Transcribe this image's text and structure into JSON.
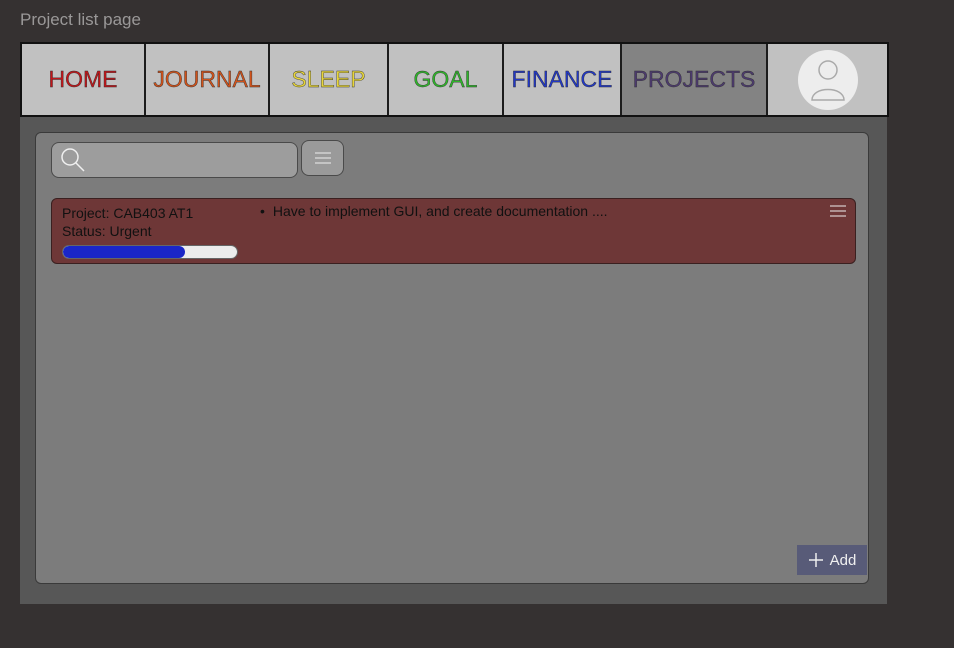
{
  "page": {
    "label": "Project list page"
  },
  "nav": {
    "tabs": [
      {
        "label": "HOME",
        "color": "#c0161a"
      },
      {
        "label": "JOURNAL",
        "color": "#d1521a"
      },
      {
        "label": "SLEEP",
        "color": "#e8d63a"
      },
      {
        "label": "GOAL",
        "color": "#2fb52a"
      },
      {
        "label": "FINANCE",
        "color": "#2238c6"
      },
      {
        "label": "PROJECTS",
        "color": "#4c3a6e",
        "active": true
      }
    ],
    "profile_icon": "user-icon"
  },
  "toolbar": {
    "search_placeholder": "",
    "search_icon": "search-icon",
    "filter_icon": "menu-icon"
  },
  "projects": [
    {
      "title": "Project: CAB403 AT1",
      "status": "Status: Urgent",
      "progress": 0.7,
      "note": "Have to implement GUI, and create documentation ....",
      "color": "#6e3737"
    }
  ],
  "add_button": {
    "label": "Add",
    "icon": "plus-icon"
  }
}
